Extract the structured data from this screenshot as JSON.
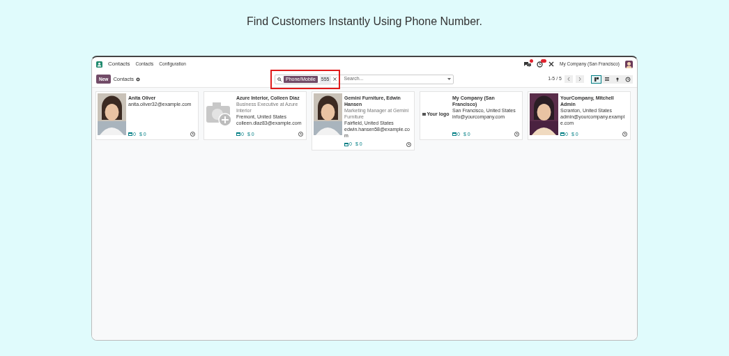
{
  "heading": "Find Customers Instantly Using Phone Number.",
  "navbar": {
    "app": "Contacts",
    "menu": [
      "Contacts",
      "Configuration"
    ],
    "company": "My Company (San Francisco)"
  },
  "control_panel": {
    "new_button": "New",
    "breadcrumb": "Contacts",
    "facet": {
      "field": "Phone/Mobile",
      "value": "555"
    },
    "search_placeholder": "Search...",
    "pager": "1-5 / 5",
    "views": [
      {
        "kind": "kanban",
        "selected": true
      },
      {
        "kind": "list",
        "selected": false
      },
      {
        "kind": "map",
        "selected": false
      },
      {
        "kind": "activity",
        "selected": false
      }
    ]
  },
  "cards": [
    {
      "name": "Anita Oliver",
      "lines": [
        "anita.oliver32@example.com"
      ],
      "meetings": "0",
      "sales_symbol": "$",
      "sales": "0"
    },
    {
      "kind": "placeholder",
      "name": "Azure Interior, Colleen Diaz",
      "subtitle": "Business Executive at Azure Interior",
      "lines": [
        "Fremont, United States",
        "colleen.diaz83@example.com"
      ],
      "meetings": "0",
      "sales_symbol": "$",
      "sales": "0"
    },
    {
      "name": "Gemini Furniture, Edwin Hansen",
      "subtitle": "Marketing Manager at Gemini Furniture",
      "lines": [
        "Fairfield, United States",
        "edwin.hansen58@example.com"
      ],
      "meetings": "0",
      "sales_symbol": "$",
      "sales": "0"
    },
    {
      "kind": "logo",
      "logo_text": "Your logo",
      "name": "My Company (San Francisco)",
      "lines": [
        "San Francisco, United States",
        "info@yourcompany.com"
      ],
      "meetings": "0",
      "sales_symbol": "$",
      "sales": "0"
    },
    {
      "kind": "avatar",
      "name": "YourCompany, Mitchell Admin",
      "lines": [
        "Scranton, United States",
        "admin@yourcompany.example.com"
      ],
      "meetings": "0",
      "sales_symbol": "$",
      "sales": "0"
    }
  ]
}
